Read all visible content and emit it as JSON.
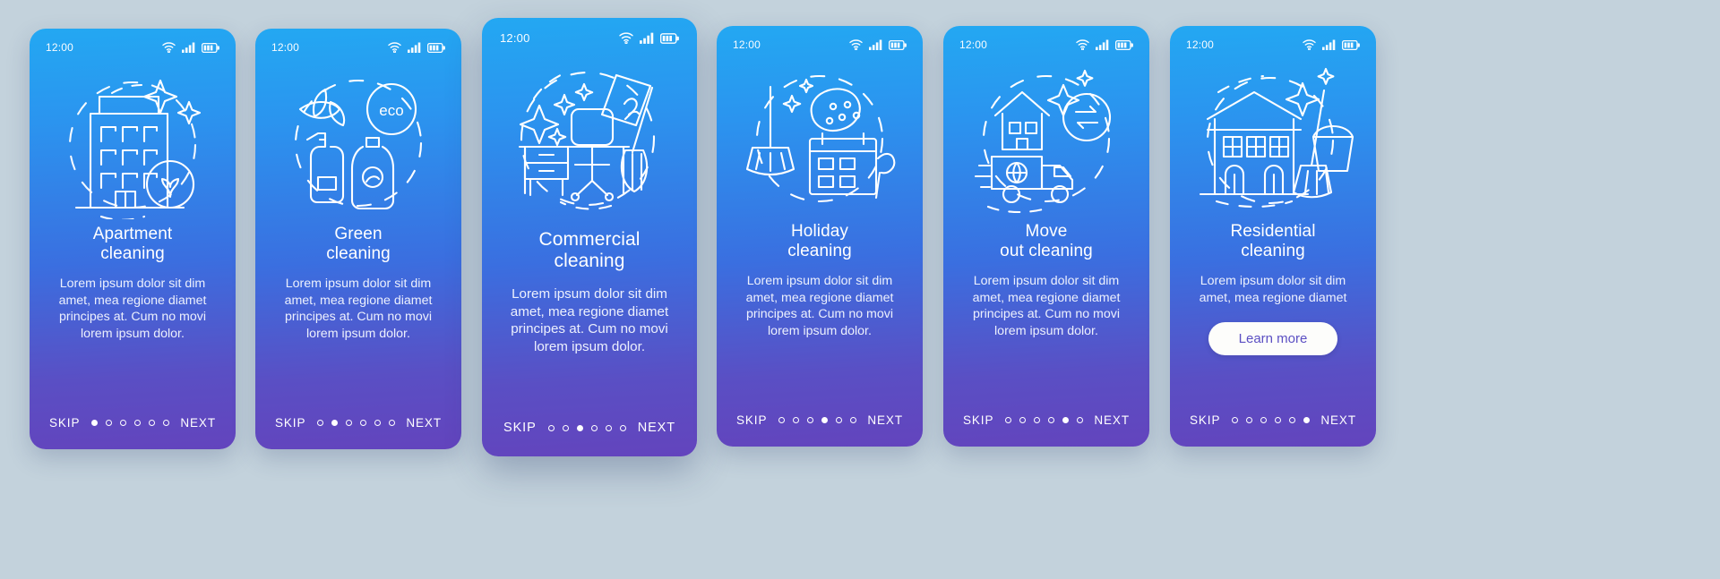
{
  "page": {
    "background_color": "#c3d2dc",
    "gradient_top": "#23a8f2",
    "gradient_bottom": "#6344bd",
    "status_time": "12:00"
  },
  "nav_labels": {
    "skip": "SKIP",
    "next": "NEXT"
  },
  "body_text": "Lorem ipsum dolor sit dim amet, mea regione diamet principes at. Cum no movi lorem ipsum dolor.",
  "body_text_short": "Lorem ipsum dolor sit dim amet, mea regione diamet",
  "icons": {
    "wifi": "wifi-icon",
    "signal": "signal-bars-icon",
    "battery": "battery-icon"
  },
  "screens": [
    {
      "id": "apartment-cleaning",
      "title_line1": "Apartment",
      "title_line2": "cleaning",
      "time": "12:00",
      "body": "Lorem ipsum dolor sit dim amet, mea regione diamet principes at. Cum no movi lorem ipsum dolor.",
      "illustration": "apartment-building-icon",
      "dots_total": 6,
      "dot_active": 1,
      "skip": "SKIP",
      "next": "NEXT",
      "has_button": false,
      "button_label": ""
    },
    {
      "id": "green-cleaning",
      "title_line1": "Green",
      "title_line2": "cleaning",
      "time": "12:00",
      "body": "Lorem ipsum dolor sit dim amet, mea regione diamet principes at. Cum no movi lorem ipsum dolor.",
      "illustration": "eco-spray-bottle-icon",
      "eco_label": "eco",
      "dots_total": 6,
      "dot_active": 2,
      "skip": "SKIP",
      "next": "NEXT",
      "has_button": false,
      "button_label": ""
    },
    {
      "id": "commercial-cleaning",
      "title_line1": "Commercial",
      "title_line2": "cleaning",
      "time": "12:00",
      "body": "Lorem ipsum dolor sit dim amet, mea regione diamet principes at. Cum no movi lorem ipsum dolor.",
      "illustration": "office-desk-mop-icon",
      "dots_total": 6,
      "dot_active": 3,
      "skip": "SKIP",
      "next": "NEXT",
      "has_button": false,
      "button_label": ""
    },
    {
      "id": "holiday-cleaning",
      "title_line1": "Holiday",
      "title_line2": "cleaning",
      "time": "12:00",
      "body": "Lorem ipsum dolor sit dim amet, mea regione diamet principes at. Cum no movi lorem ipsum dolor.",
      "illustration": "broom-sponge-calendar-icon",
      "dots_total": 6,
      "dot_active": 4,
      "skip": "SKIP",
      "next": "NEXT",
      "has_button": false,
      "button_label": ""
    },
    {
      "id": "move-out-cleaning",
      "title_line1": "Move",
      "title_line2": "out cleaning",
      "time": "12:00",
      "body": "Lorem ipsum dolor sit dim amet, mea regione diamet principes at. Cum no movi lorem ipsum dolor.",
      "illustration": "house-moving-truck-icon",
      "dots_total": 6,
      "dot_active": 5,
      "skip": "SKIP",
      "next": "NEXT",
      "has_button": false,
      "button_label": ""
    },
    {
      "id": "residential-cleaning",
      "title_line1": "Residential",
      "title_line2": "cleaning",
      "time": "12:00",
      "body": "Lorem ipsum dolor sit dim amet, mea regione diamet",
      "illustration": "house-broom-bucket-icon",
      "dots_total": 6,
      "dot_active": 6,
      "skip": "SKIP",
      "next": "NEXT",
      "has_button": true,
      "button_label": "Learn more"
    }
  ]
}
